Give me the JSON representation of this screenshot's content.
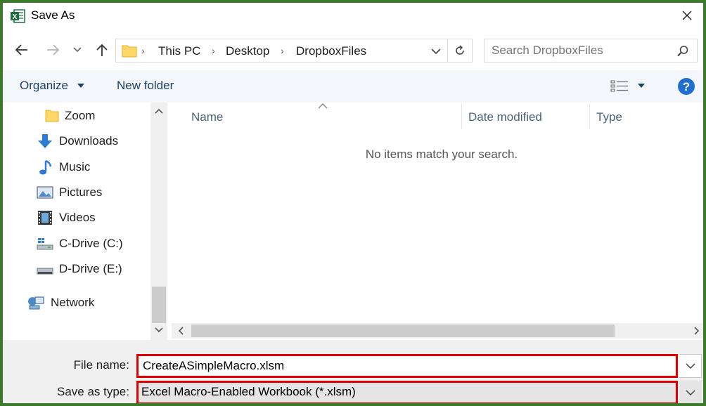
{
  "window": {
    "title": "Save As",
    "close_symbol": "✕"
  },
  "address": {
    "crumbs": [
      "This PC",
      "Desktop",
      "DropboxFiles"
    ],
    "search_placeholder": "Search DropboxFiles"
  },
  "toolbar": {
    "organize_label": "Organize",
    "new_folder_label": "New folder"
  },
  "nav": {
    "items": [
      {
        "label": "Zoom",
        "icon": "folder-icon"
      },
      {
        "label": "Downloads",
        "icon": "download-icon"
      },
      {
        "label": "Music",
        "icon": "music-icon"
      },
      {
        "label": "Pictures",
        "icon": "pictures-icon"
      },
      {
        "label": "Videos",
        "icon": "videos-icon"
      },
      {
        "label": "C-Drive (C:)",
        "icon": "drive-icon"
      },
      {
        "label": "D-Drive (E:)",
        "icon": "drive-icon"
      },
      {
        "label": "Network",
        "icon": "network-icon"
      }
    ]
  },
  "filelist": {
    "columns": [
      "Name",
      "Date modified",
      "Type"
    ],
    "empty_message": "No items match your search."
  },
  "form": {
    "file_name_label": "File name:",
    "file_name_value": "CreateASimpleMacro.xlsm",
    "save_type_label": "Save as type:",
    "save_type_value": "Excel Macro-Enabled Workbook (*.xlsm)"
  },
  "colors": {
    "frame": "#3a7a2a",
    "highlight": "#e00000",
    "help": "#1f6fd0"
  }
}
